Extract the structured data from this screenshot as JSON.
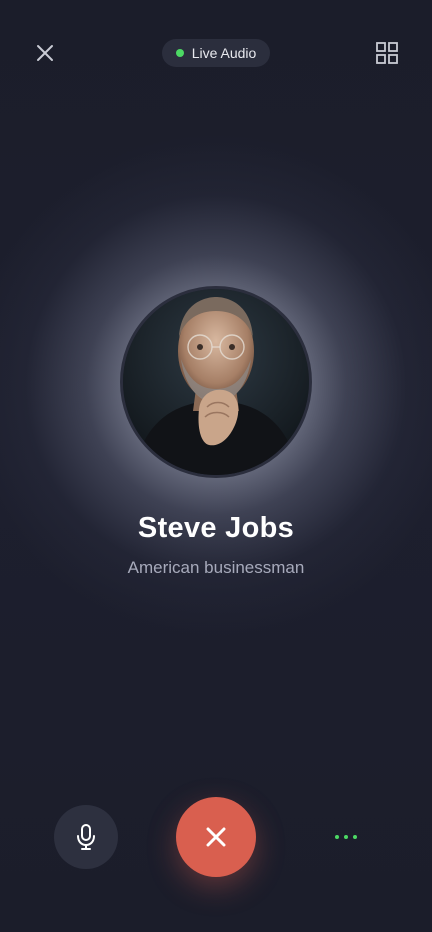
{
  "header": {
    "status_label": "Live Audio",
    "status_color": "#4cd964",
    "close_icon": "close-icon",
    "grid_icon": "grid-icon"
  },
  "profile": {
    "name": "Steve Jobs",
    "description": "American businessman",
    "avatar": "portrait-photo"
  },
  "controls": {
    "mic_icon": "microphone-icon",
    "end_call_icon": "close-icon",
    "more_icon": "more-dots-icon",
    "end_call_color": "#d95f4f",
    "accent_color": "#4cd964"
  }
}
